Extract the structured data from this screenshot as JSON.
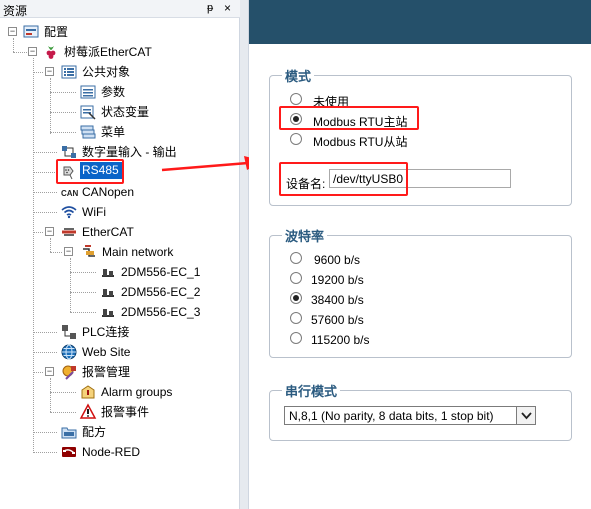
{
  "panel": {
    "title": "资源",
    "pin": "ᵽ",
    "close": "×"
  },
  "tree": {
    "config": "配置",
    "raspberry": "树莓派EtherCAT",
    "public_objects": "公共对象",
    "params": "参数",
    "state_vars": "状态变量",
    "menu": "菜单",
    "digital_io": "数字量输入 - 输出",
    "rs485": "RS485",
    "canopen": "CANopen",
    "wifi": "WiFi",
    "ethercat": "EtherCAT",
    "main_network": "Main network",
    "dev1": "2DM556-EC_1",
    "dev2": "2DM556-EC_2",
    "dev3": "2DM556-EC_3",
    "plc": "PLC连接",
    "website": "Web Site",
    "alarm_mgmt": "报警管理",
    "alarm_groups": "Alarm groups",
    "alarm_events": "报警事件",
    "recipe": "配方",
    "nodered": "Node-RED"
  },
  "mode": {
    "legend": "模式",
    "options": [
      "未使用",
      "Modbus RTU主站",
      "Modbus RTU从站"
    ],
    "selected": 1
  },
  "device": {
    "label": "设备名:",
    "value": "/dev/ttyUSB0"
  },
  "baud": {
    "legend": "波特率",
    "options": [
      "9600 b/s",
      "19200 b/s",
      "38400 b/s",
      "57600 b/s",
      "115200 b/s"
    ],
    "selected": 2
  },
  "serial_mode": {
    "legend": "串行模式",
    "value": "N,8,1 (No parity, 8 data bits, 1 stop bit)"
  },
  "colors": {
    "header": "#25506a",
    "highlight": "#ff1a1a",
    "selection": "#0a64c8",
    "legend": "#2b5b80"
  }
}
